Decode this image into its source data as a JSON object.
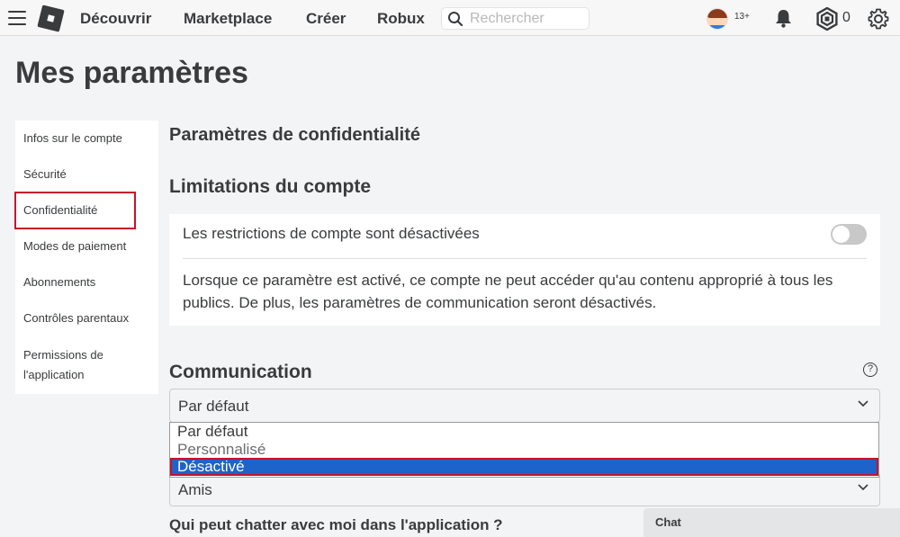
{
  "nav": {
    "links": [
      "Découvrir",
      "Marketplace",
      "Créer",
      "Robux"
    ],
    "search_placeholder": "Rechercher",
    "age_badge": "13+",
    "robux_count": "0",
    "icons": [
      "menu-icon",
      "roblox-logo",
      "search-icon",
      "avatar",
      "bell-icon",
      "robux-icon",
      "gear-icon"
    ]
  },
  "page": {
    "title": "Mes paramètres"
  },
  "sidebar": {
    "items": [
      {
        "label": "Infos sur le compte"
      },
      {
        "label": "Sécurité"
      },
      {
        "label": "Confidentialité"
      },
      {
        "label": "Modes de paiement"
      },
      {
        "label": "Abonnements"
      },
      {
        "label": "Contrôles parentaux"
      },
      {
        "label": "Permissions de"
      },
      {
        "label": "l'application"
      }
    ],
    "selected": "Confidentialité"
  },
  "privacy": {
    "heading": "Paramètres de confidentialité",
    "limits_heading": "Limitations du compte",
    "restriction_label": "Les restrictions de compte sont désactivées",
    "restriction_enabled": false,
    "restriction_desc": "Lorsque ce paramètre est activé, ce compte ne peut accéder qu'au contenu approprié à tous les publics. De plus, les paramètres de communication seront désactivés.",
    "communication_heading": "Communication",
    "help_symbol": "?",
    "communication_select": "Par défaut",
    "dropdown_options": [
      "Par défaut",
      "Personnalisé",
      "Désactivé"
    ],
    "highlighted_option": "Désactivé",
    "second_select": "Amis",
    "chat_question": "Qui peut chatter avec moi dans l'application ?"
  },
  "chat": {
    "label": "Chat"
  },
  "colors": {
    "accent_blue": "#1e63c9",
    "highlight_red": "#c8102e",
    "background": "#f2f4f5"
  }
}
